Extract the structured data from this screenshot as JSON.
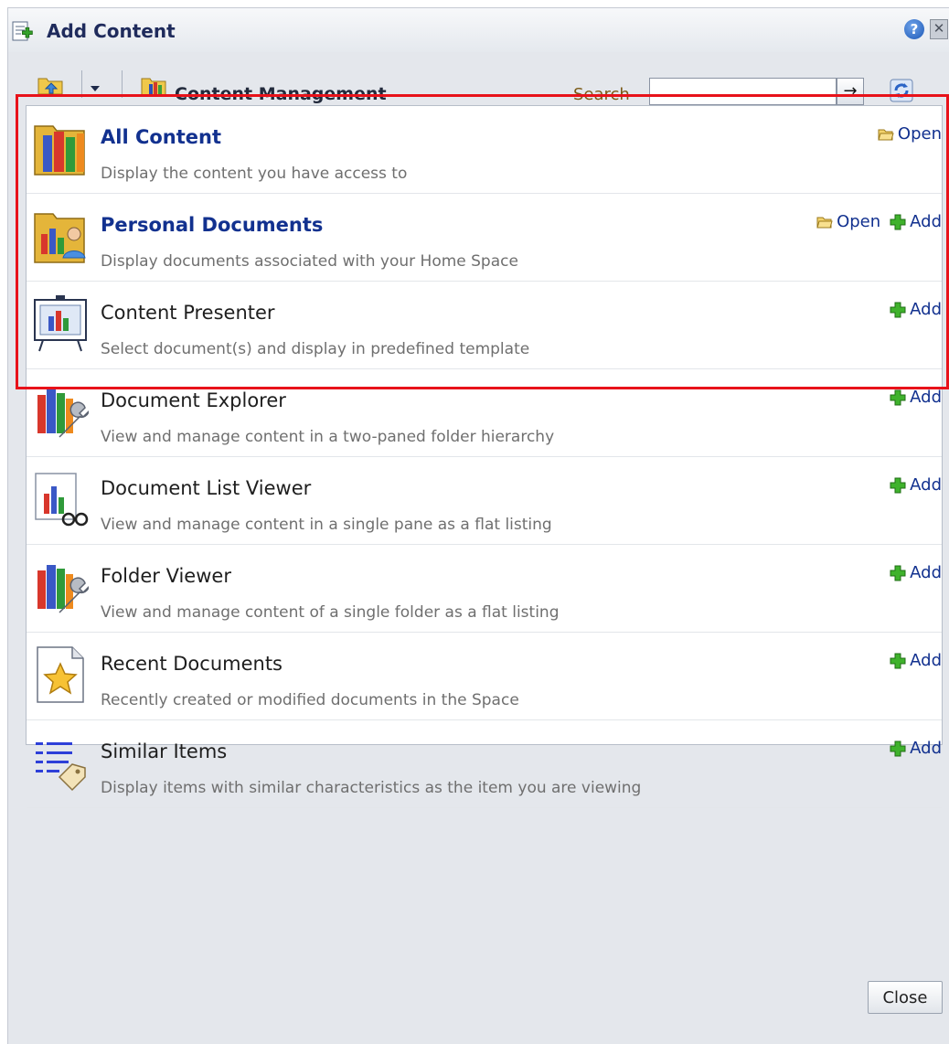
{
  "dialog": {
    "title": "Add Content",
    "help_glyph": "?",
    "close_glyph": "✕"
  },
  "toolbar": {
    "location": "Content Management",
    "search_label": "Search",
    "search_value": "",
    "search_go_glyph": "→",
    "icons": [
      "folder-up-icon",
      "dropdown-arrow-icon",
      "content-folder-icon",
      "refresh-icon"
    ]
  },
  "items": [
    {
      "title": "All Content",
      "description": "Display the content you have access to",
      "icon": "books-folder-icon",
      "title_is_link": true,
      "actions": [
        "Open"
      ]
    },
    {
      "title": "Personal Documents",
      "description": "Display documents associated with your Home Space",
      "icon": "personal-documents-icon",
      "title_is_link": true,
      "actions": [
        "Open",
        "Add"
      ]
    },
    {
      "title": "Content Presenter",
      "description": "Select document(s) and display in predefined template",
      "icon": "presentation-board-icon",
      "title_is_link": false,
      "actions": [
        "Add"
      ]
    },
    {
      "title": "Document Explorer",
      "description": "View and manage content in a two-paned folder hierarchy",
      "icon": "books-wrench-icon",
      "title_is_link": false,
      "actions": [
        "Add"
      ]
    },
    {
      "title": "Document List Viewer",
      "description": "View and manage content in a single pane as a flat listing",
      "icon": "list-viewer-glasses-icon",
      "title_is_link": false,
      "actions": [
        "Add"
      ]
    },
    {
      "title": "Folder Viewer",
      "description": "View and manage content of a single folder as a flat listing",
      "icon": "books-wrench-icon",
      "title_is_link": false,
      "actions": [
        "Add"
      ]
    },
    {
      "title": "Recent Documents",
      "description": "Recently created or modified documents in the Space",
      "icon": "star-document-icon",
      "title_is_link": false,
      "actions": [
        "Add"
      ]
    },
    {
      "title": "Similar Items",
      "description": "Display items with similar characteristics as the item you are viewing",
      "icon": "list-tag-icon",
      "title_is_link": false,
      "actions": [
        "Add"
      ]
    }
  ],
  "footer": {
    "close_label": "Close"
  },
  "colors": {
    "link": "#12318f",
    "highlight": "#e8121a",
    "add_green": "#2e9b1f"
  }
}
